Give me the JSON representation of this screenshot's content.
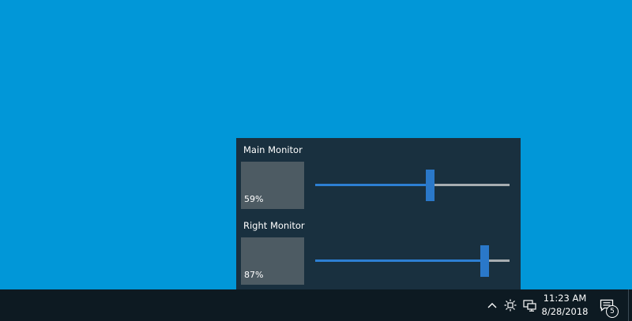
{
  "monitors": [
    {
      "name": "Main Monitor",
      "brightness_label": "59%",
      "brightness": 0.59
    },
    {
      "name": "Right Monitor",
      "brightness_label": "87%",
      "brightness": 0.87
    }
  ],
  "taskbar": {
    "time": "11:23 AM",
    "date": "8/28/2018",
    "notification_count": "5",
    "icons": [
      "chevron-up-icon",
      "brightness-icon",
      "network-icon",
      "action-center-icon"
    ]
  },
  "colors": {
    "desktop": "#0197d8",
    "flyout": "#19303f",
    "accent": "#2a78c9",
    "taskbar": "#0d1a22"
  }
}
